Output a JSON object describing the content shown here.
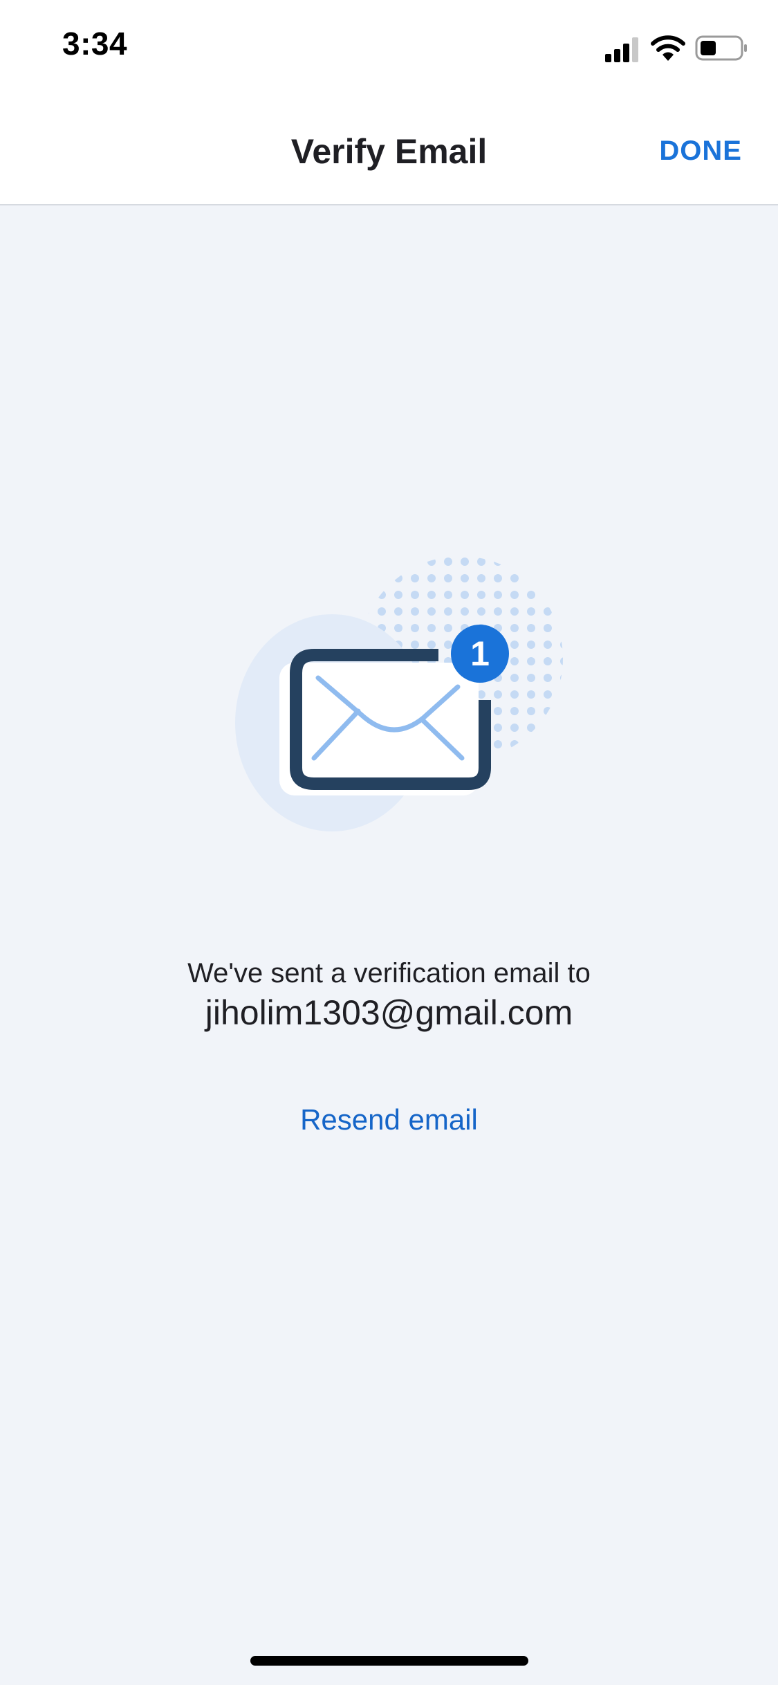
{
  "status_bar": {
    "time": "3:34",
    "icons": [
      "cellular-signal-icon",
      "wifi-icon",
      "battery-icon"
    ]
  },
  "nav": {
    "title": "Verify Email",
    "done_label": "DONE"
  },
  "illustration": {
    "icon": "envelope-icon",
    "badge_count": "1"
  },
  "content": {
    "message": "We've sent a verification email to",
    "email": "jiholim1303@gmail.com",
    "resend_label": "Resend email"
  },
  "colors": {
    "accent": "#1a73d9",
    "link": "#1565c8",
    "background": "#f1f4f9",
    "envelope_border": "#25415f",
    "envelope_lines": "#8fbbef",
    "blob": "#e2ebf8"
  }
}
